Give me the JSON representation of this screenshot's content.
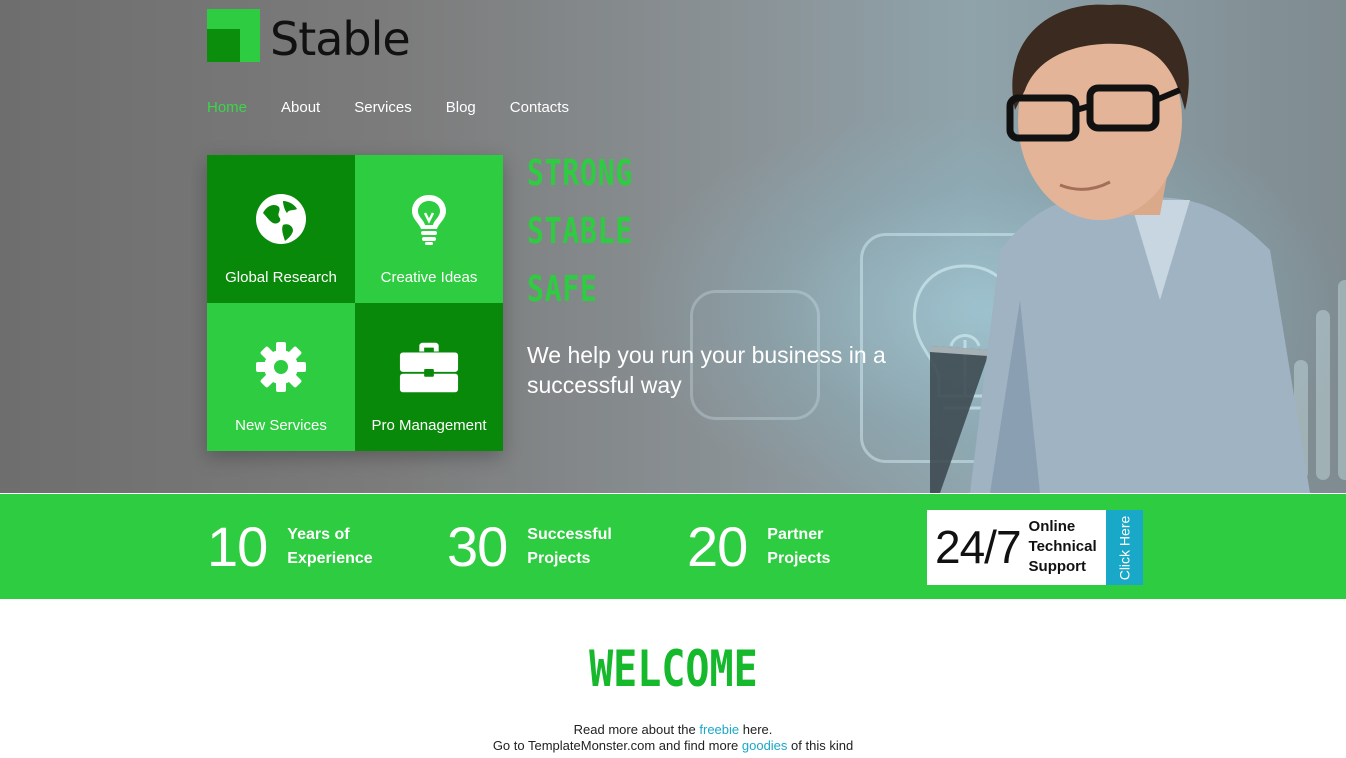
{
  "brand": {
    "name": "Stable"
  },
  "nav": [
    {
      "label": "Home",
      "active": true
    },
    {
      "label": "About"
    },
    {
      "label": "Services"
    },
    {
      "label": "Blog"
    },
    {
      "label": "Contacts"
    }
  ],
  "tiles": [
    {
      "label": "Global Research",
      "icon": "globe-icon"
    },
    {
      "label": "Creative Ideas",
      "icon": "lightbulb-icon"
    },
    {
      "label": "New Services",
      "icon": "gear-icon"
    },
    {
      "label": "Pro Management",
      "icon": "briefcase-icon"
    }
  ],
  "headline": [
    "STRONG",
    "STABLE",
    "SAFE"
  ],
  "tagline": "We help you run your business in a successful way",
  "stats": [
    {
      "number": "10",
      "label_line1": "Years of",
      "label_line2": "Experience"
    },
    {
      "number": "30",
      "label_line1": "Successful",
      "label_line2": "Projects"
    },
    {
      "number": "20",
      "label_line1": "Partner",
      "label_line2": "Projects"
    }
  ],
  "support": {
    "number": "24/7",
    "label_line1": "Online",
    "label_line2": "Technical",
    "label_line3": "Support",
    "button": "Click Here"
  },
  "welcome": {
    "title": "WELCOME",
    "line1_pre": "Read more about the ",
    "line1_link": "freebie",
    "line1_post": " here.",
    "line2_pre": "Go to TemplateMonster.com and find more ",
    "line2_link": "goodies",
    "line2_post": " of this kind"
  },
  "colors": {
    "accent": "#2ecc40",
    "accent_dark": "#098909",
    "link": "#1aa8c8"
  }
}
